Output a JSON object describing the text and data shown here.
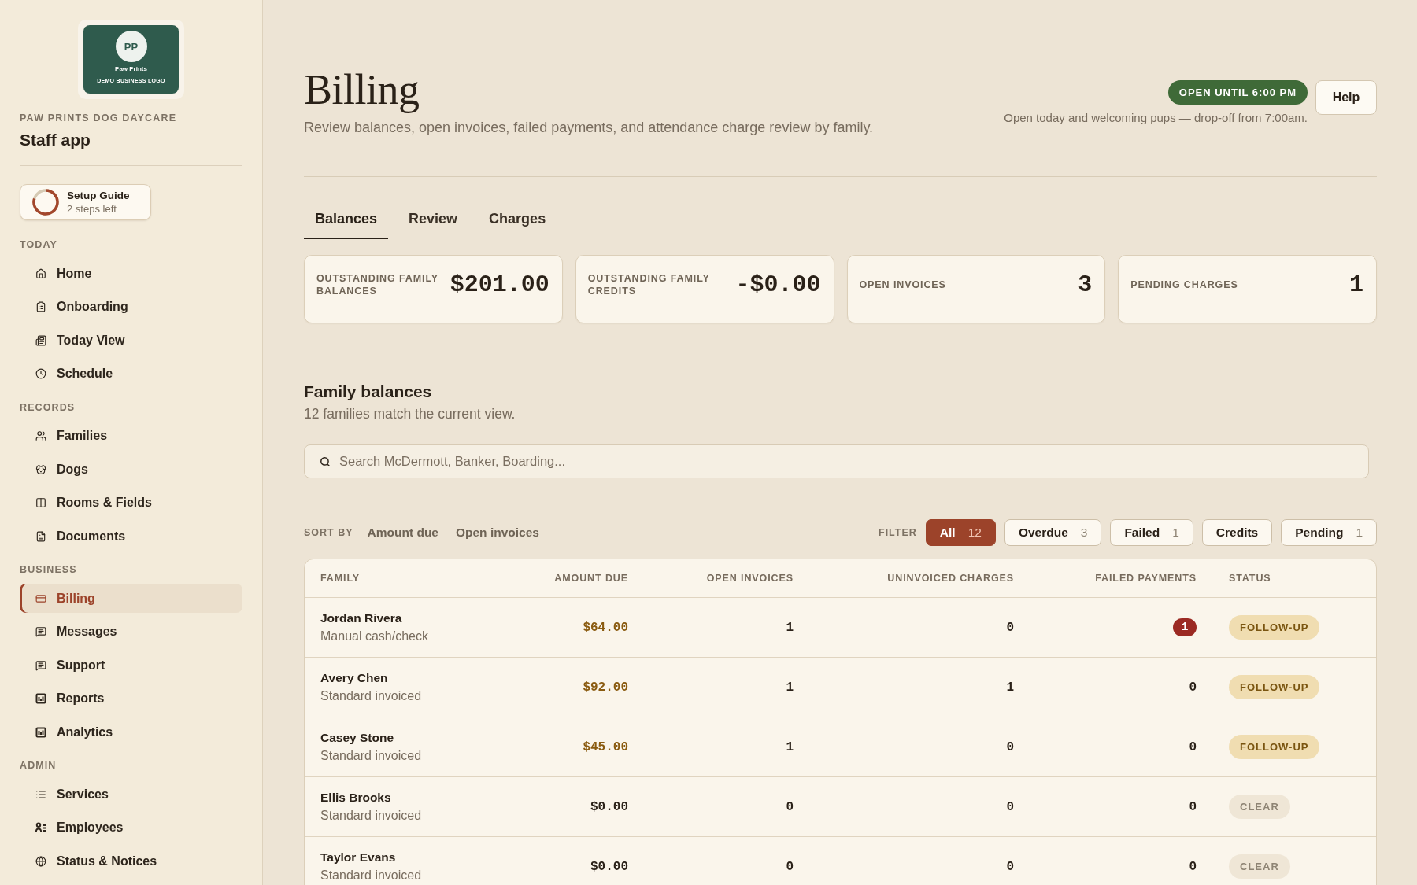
{
  "sidebar": {
    "logo": {
      "initials": "PP",
      "name": "Paw Prints",
      "tagline": "DEMO BUSINESS LOGO"
    },
    "business_name": "PAW PRINTS DOG DAYCARE",
    "app_title": "Staff app",
    "setup_guide": {
      "title": "Setup Guide",
      "subtitle": "2 steps left"
    },
    "sections": [
      {
        "label": "TODAY",
        "items": [
          {
            "label": "Home",
            "selected": false
          },
          {
            "label": "Onboarding",
            "selected": false
          },
          {
            "label": "Today View",
            "selected": false
          },
          {
            "label": "Schedule",
            "selected": false
          }
        ]
      },
      {
        "label": "RECORDS",
        "items": [
          {
            "label": "Families",
            "selected": false
          },
          {
            "label": "Dogs",
            "selected": false
          },
          {
            "label": "Rooms & Fields",
            "selected": false
          },
          {
            "label": "Documents",
            "selected": false
          }
        ]
      },
      {
        "label": "BUSINESS",
        "items": [
          {
            "label": "Billing",
            "selected": true
          },
          {
            "label": "Messages",
            "selected": false
          },
          {
            "label": "Support",
            "selected": false
          },
          {
            "label": "Reports",
            "selected": false
          },
          {
            "label": "Analytics",
            "selected": false
          }
        ]
      },
      {
        "label": "ADMIN",
        "items": [
          {
            "label": "Services",
            "selected": false
          },
          {
            "label": "Employees",
            "selected": false
          },
          {
            "label": "Status & Notices",
            "selected": false
          }
        ]
      }
    ]
  },
  "header": {
    "title": "Billing",
    "subtitle": "Review balances, open invoices, failed payments, and attendance charge review by family.",
    "hours_badge": "OPEN UNTIL 6:00 PM",
    "note": "Open today and welcoming pups — drop-off from 7:00am.",
    "help_button": "Help"
  },
  "tabs": [
    {
      "label": "Balances",
      "selected": true
    },
    {
      "label": "Review",
      "selected": false
    },
    {
      "label": "Charges",
      "selected": false
    }
  ],
  "stats": [
    {
      "label": "OUTSTANDING FAMILY BALANCES",
      "value": "$201.00"
    },
    {
      "label": "OUTSTANDING FAMILY CREDITS",
      "value": "-$0.00"
    },
    {
      "label": "OPEN INVOICES",
      "value": "3"
    },
    {
      "label": "PENDING CHARGES",
      "value": "1"
    }
  ],
  "family_balances": {
    "title": "Family balances",
    "subtitle": "12 families match the current view.",
    "search": {
      "placeholder": "Search McDermott, Banker, Boarding..."
    },
    "sort": {
      "label": "SORT BY",
      "options": [
        "Amount due",
        "Open invoices"
      ]
    },
    "filter": {
      "label": "FILTER",
      "chips": [
        {
          "label": "All",
          "count": "12",
          "selected": true
        },
        {
          "label": "Overdue",
          "count": "3",
          "selected": false
        },
        {
          "label": "Failed",
          "count": "1",
          "selected": false
        },
        {
          "label": "Credits",
          "selected": false
        },
        {
          "label": "Pending",
          "count": "1",
          "selected": false
        }
      ]
    },
    "table": {
      "columns": [
        "FAMILY",
        "AMOUNT DUE",
        "OPEN INVOICES",
        "UNINVOICED CHARGES",
        "FAILED PAYMENTS",
        "STATUS"
      ],
      "rows": [
        {
          "family": "Jordan Rivera",
          "plan": "Manual cash/check",
          "amount_due": "$64.00",
          "open_invoices": "1",
          "uninvoiced_charges": "0",
          "failed_payments": "1",
          "failed_flagged": true,
          "kind": "follow_up",
          "status": "FOLLOW-UP"
        },
        {
          "family": "Avery Chen",
          "plan": "Standard invoiced",
          "amount_due": "$92.00",
          "open_invoices": "1",
          "uninvoiced_charges": "1",
          "failed_payments": "0",
          "failed_flagged": false,
          "kind": "follow_up",
          "status": "FOLLOW-UP"
        },
        {
          "family": "Casey Stone",
          "plan": "Standard invoiced",
          "amount_due": "$45.00",
          "open_invoices": "1",
          "uninvoiced_charges": "0",
          "failed_payments": "0",
          "failed_flagged": false,
          "kind": "follow_up",
          "status": "FOLLOW-UP"
        },
        {
          "family": "Ellis Brooks",
          "plan": "Standard invoiced",
          "amount_due": "$0.00",
          "open_invoices": "0",
          "uninvoiced_charges": "0",
          "failed_payments": "0",
          "failed_flagged": false,
          "kind": "clear",
          "status": "CLEAR"
        },
        {
          "family": "Taylor Evans",
          "plan": "Standard invoiced",
          "amount_due": "$0.00",
          "open_invoices": "0",
          "uninvoiced_charges": "0",
          "failed_payments": "0",
          "failed_flagged": false,
          "kind": "clear",
          "status": "CLEAR"
        }
      ]
    }
  }
}
